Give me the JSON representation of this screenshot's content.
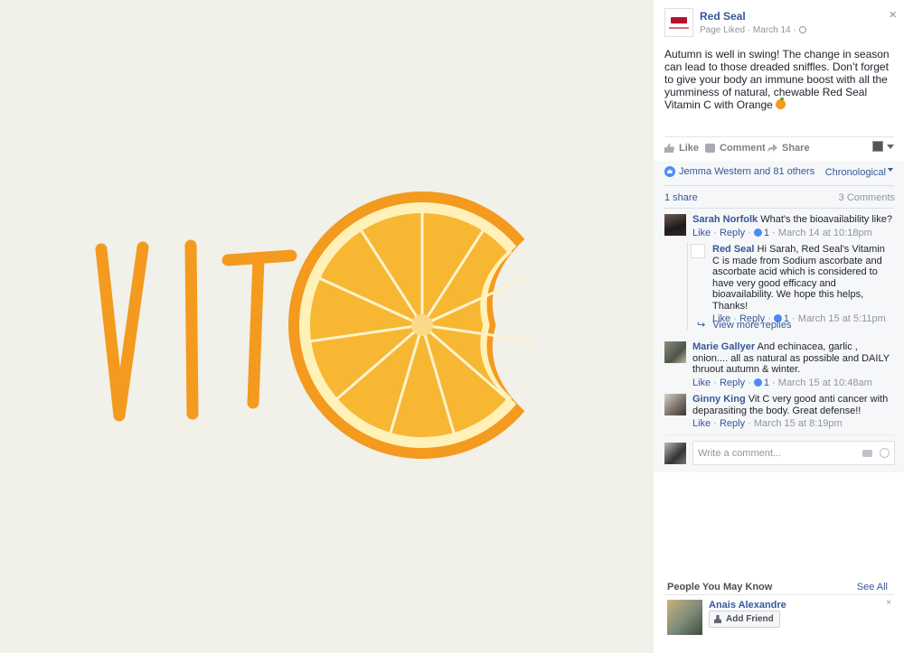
{
  "photo": {
    "caption_letters": [
      "V",
      "I",
      "T"
    ],
    "colors": {
      "background": "#f1f0e9",
      "orange": "#f39a1f",
      "rind": "#fff1b8",
      "pulp": "#f7b733"
    }
  },
  "post": {
    "page_name": "Red Seal",
    "meta": "Page Liked · March 14 ·",
    "text": "Autumn is well in swing! The change in season can lead to those dreaded sniffles. Don’t forget to give your body an immune boost with all the yumminess of natural, chewable Red Seal Vitamin C with Orange",
    "emoji": "orange-emoji",
    "close_label": "×"
  },
  "actions": {
    "like": "Like",
    "comment": "Comment",
    "share": "Share"
  },
  "feedback": {
    "reactions": "Jemma Western and 81 others",
    "order": "Chronological",
    "shares": "1 share",
    "comments_count": "3 Comments"
  },
  "comments": [
    {
      "author": "Sarah Norfolk",
      "text": "What's the bioavailability like?",
      "like": "Like",
      "reply": "Reply",
      "likes": "1",
      "time": "March 14 at 10:18pm"
    },
    {
      "author": "Marie Gallyer",
      "text": "And echinacea, garlic , onion.... all as natural as possible and DAILY thruout autumn & winter.",
      "like": "Like",
      "reply": "Reply",
      "likes": "1",
      "time": "March 15 at 10:48am"
    },
    {
      "author": "Ginny King",
      "text": "Vit C very good anti cancer with deparasiting the body. Great defense!!",
      "like": "Like",
      "reply": "Reply",
      "time": "March 15 at 8:19pm"
    }
  ],
  "reply": {
    "author": "Red Seal",
    "text": "Hi Sarah, Red Seal's Vitamin C is made from Sodium ascorbate and ascorbate acid which is considered to have very good efficacy and bioavailability. We hope this helps, Thanks!",
    "like": "Like",
    "reply": "Reply",
    "likes": "1",
    "time": "March 15 at 5:11pm",
    "more": "View more replies"
  },
  "composer": {
    "placeholder": "Write a comment..."
  },
  "pymk": {
    "title": "People You May Know",
    "see_all": "See All",
    "person": "Anais Alexandre",
    "add_friend": "Add Friend",
    "dismiss": "×"
  }
}
